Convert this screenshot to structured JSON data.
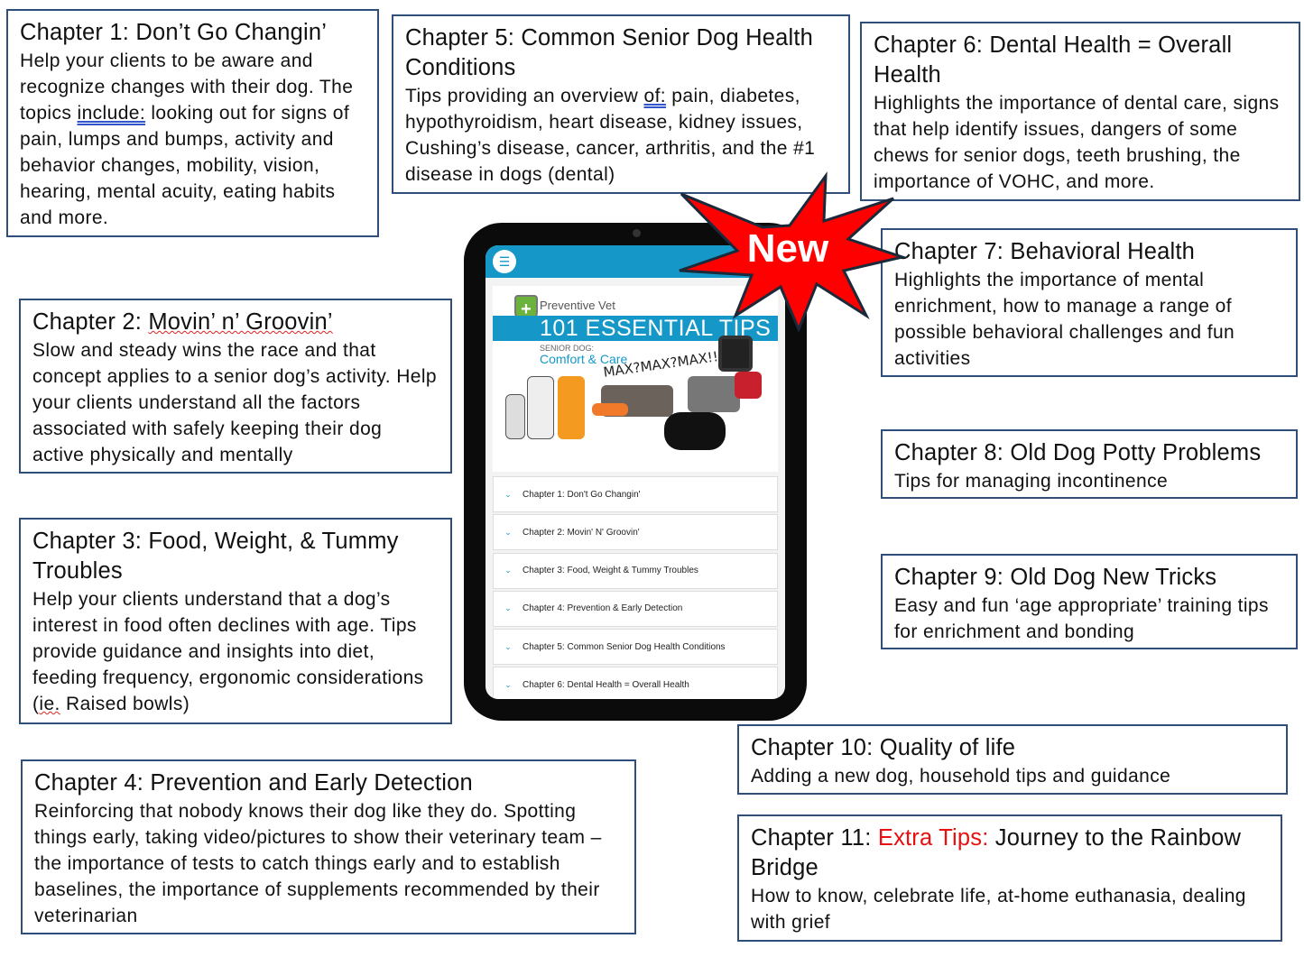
{
  "chapters": {
    "c1": {
      "title": "Chapter 1: Don’t Go Changin’",
      "body_pre": "Help your clients to be aware and recognize changes with their dog. The topics ",
      "body_u": "include:",
      "body_post": " looking out for signs of pain, lumps and bumps, activity and behavior changes, mobility, vision, hearing, mental acuity, eating habits and more."
    },
    "c2": {
      "title_pre": "Chapter 2: ",
      "title_sq": "Movin’ n’ Groovin’",
      "body": "Slow and steady wins the race and that concept applies to a senior dog’s activity. Help your clients understand all the factors associated with safely keeping their dog active physically and mentally"
    },
    "c3": {
      "title": "Chapter 3: Food, Weight, & Tummy Troubles",
      "body_pre": "Help your clients understand that a dog’s interest in food often declines with age. Tips provide guidance and insights into diet, feeding frequency, ergonomic considerations (",
      "body_sq": "ie.",
      "body_post": " Raised bowls)"
    },
    "c4": {
      "title": "Chapter 4: Prevention and Early Detection",
      "body": "Reinforcing that nobody knows their dog like they do. Spotting things early, taking video/pictures to show their veterinary team – the importance of tests to catch things early and to establish baselines, the importance of supplements recommended by their veterinarian"
    },
    "c5": {
      "title": "Chapter 5: Common Senior Dog Health Conditions",
      "body_pre": "Tips providing an overview ",
      "body_u": "of:",
      "body_post": " pain, diabetes, hypothyroidism, heart disease, kidney issues, Cushing’s disease, cancer, arthritis, and the #1 disease in dogs (dental)"
    },
    "c6": {
      "title": "Chapter 6: Dental Health = Overall Health",
      "body": "Highlights the importance of dental care, signs that help identify issues, dangers of some chews for senior dogs, teeth brushing, the importance of VOHC, and more."
    },
    "c7": {
      "title": "Chapter 7: Behavioral Health",
      "body": "Highlights the importance of mental enrichment, how to manage a range of possible behavioral challenges and fun activities"
    },
    "c8": {
      "title": "Chapter 8: Old Dog Potty Problems",
      "body": "Tips for managing incontinence"
    },
    "c9": {
      "title": "Chapter 9: Old Dog New Tricks",
      "body": "Easy and fun ‘age appropriate’ training tips for enrichment and bonding"
    },
    "c10": {
      "title": "Chapter 10: Quality of life",
      "body": "Adding a new dog, household tips and guidance"
    },
    "c11": {
      "title_pre": "Chapter 11: ",
      "title_red": "Extra Tips:",
      "title_post": " Journey to the Rainbow Bridge",
      "body": "How to know, celebrate life, at-home euthanasia, dealing with grief"
    }
  },
  "badge": {
    "label": "New",
    "color": "#ff0000"
  },
  "tablet": {
    "menu_icon": "hamburger-icon",
    "brand": "Preventive Vet",
    "cover_title": "101 ESSENTIAL TIPS",
    "cover_sub1": "SENIOR DOG:",
    "cover_sub2": "Comfort & Care",
    "cover_caption": "MAX?MAX?MAX!!",
    "accent": "#1598c8",
    "accordion": [
      "Chapter 1: Don't Go Changin'",
      "Chapter 2: Movin' N' Groovin'",
      "Chapter 3: Food, Weight & Tummy Troubles",
      "Chapter 4: Prevention & Early Detection",
      "Chapter 5: Common Senior Dog Health Conditions",
      "Chapter 6: Dental Health = Overall Health"
    ]
  }
}
